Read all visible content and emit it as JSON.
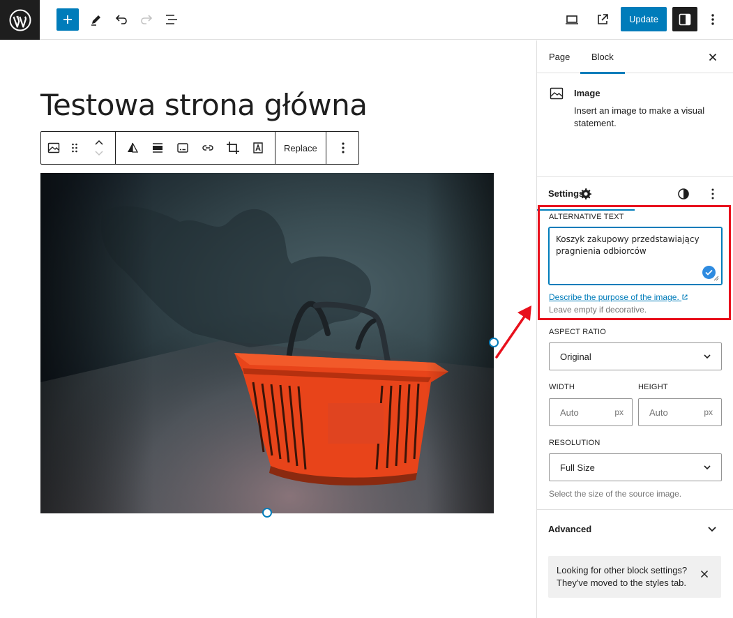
{
  "toolbar": {
    "update_label": "Update"
  },
  "editor": {
    "page_title": "Testowa strona główna",
    "block_toolbar": {
      "replace_label": "Replace"
    }
  },
  "sidebar": {
    "tabs": [
      {
        "label": "Page",
        "active": false
      },
      {
        "label": "Block",
        "active": true
      }
    ],
    "block": {
      "name": "Image",
      "description": "Insert an image to make a visual statement."
    },
    "settings": {
      "title": "Settings",
      "alt_text": {
        "label": "ALTERNATIVE TEXT",
        "value": "Koszyk zakupowy przedstawiający pragnienia odbiorców",
        "link": "Describe the purpose of the image.",
        "help": "Leave empty if decorative."
      },
      "aspect_ratio": {
        "label": "ASPECT RATIO",
        "value": "Original"
      },
      "width": {
        "label": "WIDTH",
        "placeholder": "Auto",
        "unit": "px"
      },
      "height": {
        "label": "HEIGHT",
        "placeholder": "Auto",
        "unit": "px"
      },
      "resolution": {
        "label": "RESOLUTION",
        "value": "Full Size",
        "help": "Select the size of the source image."
      }
    },
    "advanced": {
      "label": "Advanced"
    },
    "notice": {
      "text": "Looking for other block settings? They've moved to the styles tab."
    }
  },
  "colors": {
    "accent": "#007cba",
    "highlight": "#e8101c",
    "basket": "#e8441a"
  }
}
